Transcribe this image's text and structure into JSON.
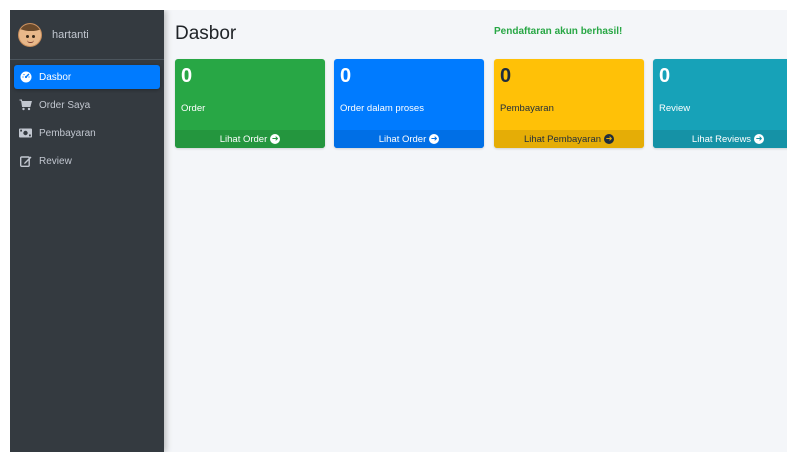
{
  "user": {
    "name": "hartanti"
  },
  "sidebar": {
    "items": [
      {
        "label": "Dasbor",
        "icon": "tachometer-icon",
        "active": true
      },
      {
        "label": "Order Saya",
        "icon": "shopping-cart-icon",
        "active": false
      },
      {
        "label": "Pembayaran",
        "icon": "money-bill-icon",
        "active": false
      },
      {
        "label": "Review",
        "icon": "edit-icon",
        "active": false
      }
    ]
  },
  "header": {
    "title": "Dasbor",
    "alert": "Pendaftaran akun berhasil!"
  },
  "boxes": [
    {
      "count": "0",
      "label": "Order",
      "link": "Lihat Order",
      "color": "#28a745",
      "footer_color": "#24963e"
    },
    {
      "count": "0",
      "label": "Order dalam proses",
      "link": "Lihat Order",
      "color": "#007bff",
      "footer_color": "#006fe6"
    },
    {
      "count": "0",
      "label": "Pembayaran",
      "link": "Lihat Pembayaran",
      "color": "#ffc107",
      "footer_color": "#e5ad06"
    },
    {
      "count": "0",
      "label": "Review",
      "link": "Lihat Reviews",
      "color": "#17a2b8",
      "footer_color": "#1592a6"
    }
  ],
  "colors": {
    "sidebar_bg": "#343a40",
    "active_nav": "#007bff",
    "content_bg": "#f4f6f9",
    "success_text": "#28a745"
  }
}
